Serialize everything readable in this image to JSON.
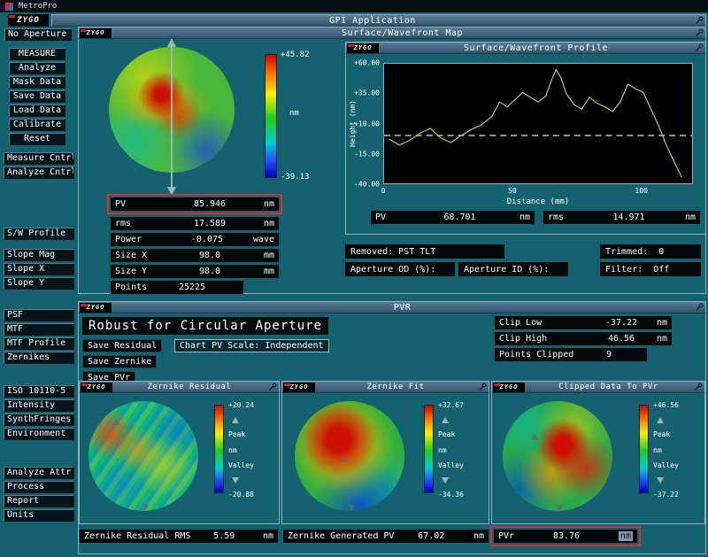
{
  "topbar": {
    "title": "MetroPro"
  },
  "brand": "ZYGO",
  "app": {
    "title": "GPI Application"
  },
  "sidebar": {
    "items": [
      {
        "label": "No Aperture",
        "variant": "plain"
      },
      {
        "label": "MEASURE",
        "variant": "boxed",
        "gap": 8
      },
      {
        "label": "Analyze",
        "variant": "boxed"
      },
      {
        "label": "Mask Data",
        "variant": "boxed"
      },
      {
        "label": "Save Data",
        "variant": "boxed"
      },
      {
        "label": "Load Data",
        "variant": "boxed"
      },
      {
        "label": "Calibrate",
        "variant": "boxed"
      },
      {
        "label": "Reset",
        "variant": "boxed"
      },
      {
        "label": "Measure Cntrl",
        "gap": 8
      },
      {
        "label": "Analyze Cntrl"
      },
      {
        "label": "S/W Profile",
        "gap": 55
      },
      {
        "label": "Slope Mag",
        "gap": 10
      },
      {
        "label": "Slope X"
      },
      {
        "label": "Slope Y"
      },
      {
        "label": "PSF",
        "gap": 22
      },
      {
        "label": "MTF"
      },
      {
        "label": "MTF Profile"
      },
      {
        "label": "Zernikes"
      },
      {
        "label": "ISO 10110-5",
        "gap": 24
      },
      {
        "label": "Intensity"
      },
      {
        "label": "SynthFringes"
      },
      {
        "label": "Environment"
      },
      {
        "label": "Analyze Attr",
        "gap": 30
      },
      {
        "label": "Process"
      },
      {
        "label": "Report"
      },
      {
        "label": "Units"
      }
    ]
  },
  "map": {
    "title": "Surface/Wavefront Map",
    "scale": {
      "top": "+45.82",
      "unit": "nm",
      "bottom": "-39.13"
    },
    "stats": [
      {
        "label": "PV",
        "value": "85.946",
        "unit": "nm",
        "highlight": true
      },
      {
        "label": "rms",
        "value": "17.589",
        "unit": "nm"
      },
      {
        "label": "Power",
        "value": "-0.075",
        "unit": "wave"
      },
      {
        "label": "Size X",
        "value": "98.0",
        "unit": "mm"
      },
      {
        "label": "Size Y",
        "value": "98.0",
        "unit": "mm"
      },
      {
        "label": "Points",
        "value": "25225",
        "unit": ""
      }
    ]
  },
  "profile": {
    "title": "Surface/Wavefront Profile",
    "ylabel": "Height (nm)",
    "xlabel": "Distance (mm)",
    "yticks": [
      "+60.00",
      "+35.00",
      "+10.00",
      "-15.00",
      "-40.00"
    ],
    "xticks": [
      "0",
      "50",
      "100"
    ],
    "stats": [
      {
        "label": "PV",
        "value": "68.701",
        "unit": "nm"
      },
      {
        "label": "rms",
        "value": "14.971",
        "unit": "nm"
      }
    ],
    "chart_data": {
      "type": "line",
      "xlabel": "Distance (mm)",
      "ylabel": "Height (nm)",
      "xlim": [
        0,
        120
      ],
      "ylim": [
        -40,
        60
      ],
      "ref_line": 0,
      "x": [
        2,
        6,
        10,
        14,
        18,
        22,
        26,
        30,
        34,
        38,
        42,
        45,
        48,
        51,
        54,
        57,
        60,
        63,
        65,
        67,
        69,
        71,
        74,
        77,
        80,
        83,
        86,
        89,
        92,
        95,
        98,
        101,
        104,
        107,
        110,
        113,
        116
      ],
      "y": [
        -3,
        -8,
        -4,
        2,
        6,
        -2,
        -6,
        0,
        5,
        9,
        16,
        28,
        24,
        30,
        36,
        32,
        28,
        33,
        45,
        55,
        48,
        35,
        26,
        22,
        32,
        27,
        24,
        20,
        28,
        43,
        39,
        36,
        22,
        8,
        -8,
        -22,
        -35
      ]
    }
  },
  "info": {
    "removed": "Removed: PST TLT",
    "trimmed": "Trimmed:  0",
    "aperture_od": "Aperture OD (%):",
    "aperture_id": "Aperture ID (%):",
    "filter": "Filter:  Off"
  },
  "pvr": {
    "title": "PVR",
    "heading": "Robust for Circular Aperture",
    "buttons": [
      "Save Residual",
      "Chart PV Scale: Independent",
      "Save Zernike",
      "Save PVr"
    ],
    "clip": [
      {
        "label": "Clip Low",
        "value": "-37.22",
        "unit": "nm"
      },
      {
        "label": "Clip High",
        "value": "46.56",
        "unit": "nm"
      },
      {
        "label": "Points Clipped",
        "value": "9",
        "unit": ""
      }
    ],
    "panels": [
      {
        "title": "Zernike Residual",
        "scale_top": "+20.24",
        "peak": "Peak",
        "unit": "nm",
        "valley": "Valley",
        "scale_bottom": "-20.88"
      },
      {
        "title": "Zernike Fit",
        "scale_top": "+32.67",
        "peak": "Peak",
        "unit": "nm",
        "valley": "Valley",
        "scale_bottom": "-34.36"
      },
      {
        "title": "Clipped Data To PVr",
        "scale_top": "+46.56",
        "peak": "Peak",
        "unit": "nm",
        "valley": "Valley",
        "scale_bottom": "-37.22"
      }
    ],
    "bottom_stats": [
      {
        "label": "Zernike Residual RMS",
        "value": "5.59",
        "unit": "nm"
      },
      {
        "label": "Zernike Generated PV",
        "value": "67.02",
        "unit": "nm"
      },
      {
        "label": "PVr",
        "value": "83.76",
        "unit": "nm",
        "highlight": true,
        "unit_selected": true
      }
    ]
  }
}
